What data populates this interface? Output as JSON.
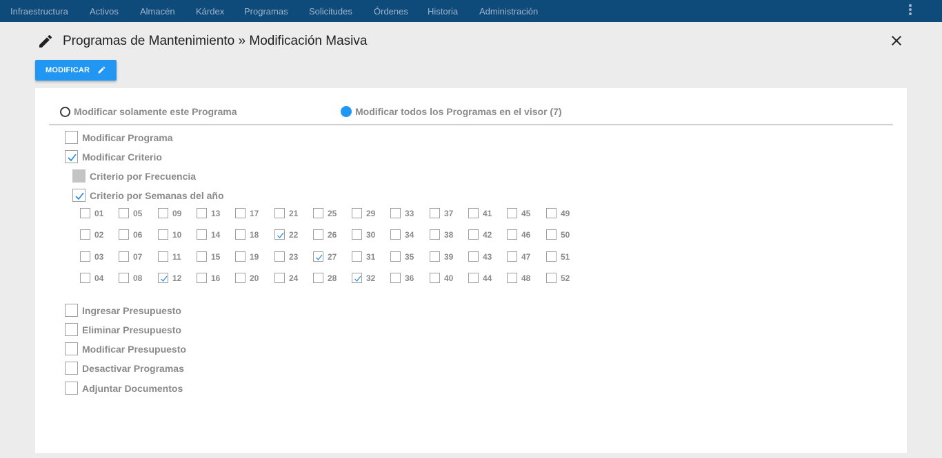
{
  "navbar": {
    "items": [
      "Infraestructura",
      "Activos",
      "Almacén",
      "Kárdex",
      "Programas",
      "Solicitudes",
      "Órdenes",
      "Historia",
      "Administración"
    ]
  },
  "header": {
    "title": "Programas de Mantenimiento » Modificación Masiva"
  },
  "toolbar": {
    "modify_label": "MODIFICAR"
  },
  "scope": {
    "option_single": "Modificar solamente este Programa",
    "option_all": "Modificar todos los Programas en el visor (7)",
    "selected": "all"
  },
  "options": {
    "modificar_programa": {
      "label": "Modificar Programa",
      "checked": false
    },
    "modificar_criterio": {
      "label": "Modificar Criterio",
      "checked": true
    },
    "criterio_frecuencia": {
      "label": "Criterio por Frecuencia",
      "checked": false,
      "disabled": true
    },
    "criterio_semanas": {
      "label": "Criterio por Semanas del año",
      "checked": true
    },
    "ingresar_presupuesto": {
      "label": "Ingresar Presupuesto",
      "checked": false
    },
    "eliminar_presupuesto": {
      "label": "Eliminar Presupuesto",
      "checked": false
    },
    "modificar_presupuesto": {
      "label": "Modificar Presupuesto",
      "checked": false
    },
    "desactivar_programas": {
      "label": "Desactivar Programas",
      "checked": false
    },
    "adjuntar_documentos": {
      "label": "Adjuntar Documentos",
      "checked": false
    }
  },
  "weeks": {
    "labels": [
      "01",
      "02",
      "03",
      "04",
      "05",
      "06",
      "07",
      "08",
      "09",
      "10",
      "11",
      "12",
      "13",
      "14",
      "15",
      "16",
      "17",
      "18",
      "19",
      "20",
      "21",
      "22",
      "23",
      "24",
      "25",
      "26",
      "27",
      "28",
      "29",
      "30",
      "31",
      "32",
      "33",
      "34",
      "35",
      "36",
      "37",
      "38",
      "39",
      "40",
      "41",
      "42",
      "43",
      "44",
      "45",
      "46",
      "47",
      "48",
      "49",
      "50",
      "51",
      "52"
    ],
    "checked": [
      "12",
      "22",
      "27",
      "32"
    ]
  },
  "colors": {
    "navbar": "#0e4a7a",
    "accent": "#2196f3",
    "background": "#ececec"
  }
}
